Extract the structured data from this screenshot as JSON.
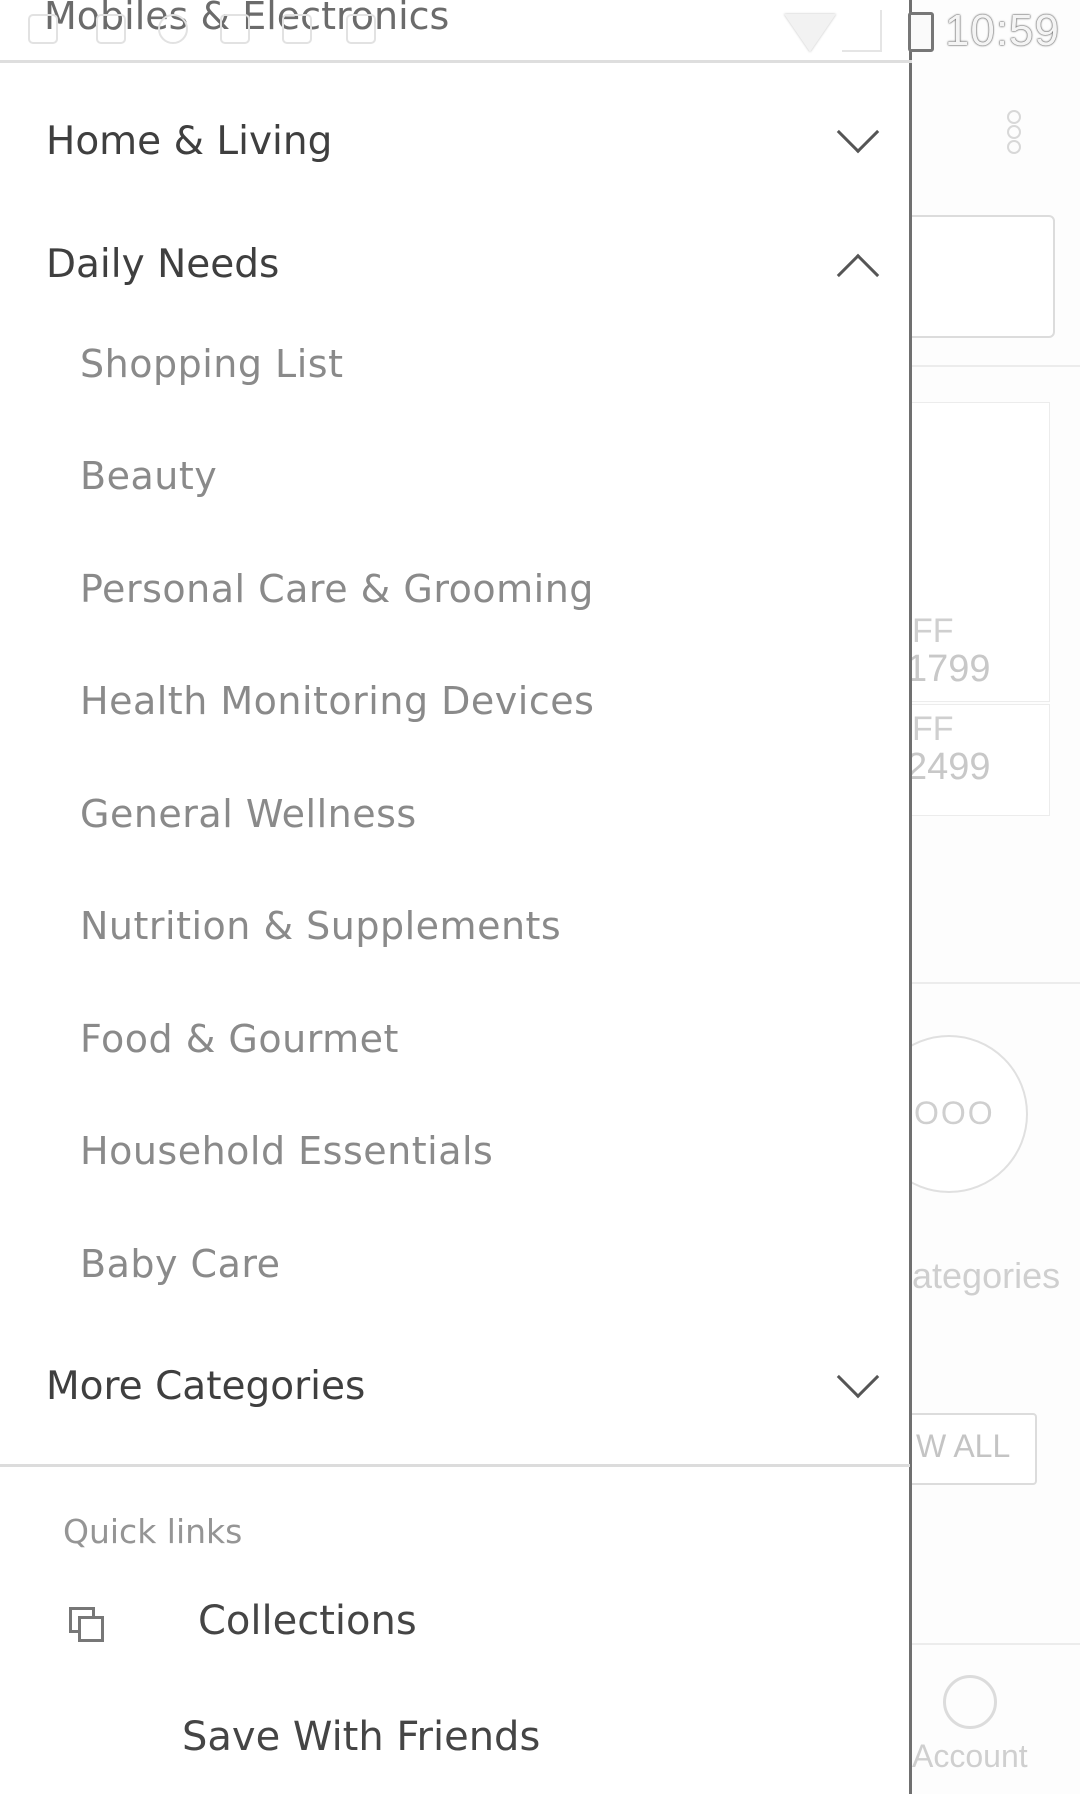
{
  "status_bar": {
    "time": "10:59"
  },
  "drawer": {
    "partial_top_title": "Mobiles & Electronics",
    "categories": [
      {
        "label": "Home & Living",
        "state": "collapsed",
        "icon": "chevron-down-icon"
      },
      {
        "label": "Daily Needs",
        "state": "expanded",
        "icon": "chevron-up-icon"
      },
      {
        "label": "More Categories",
        "state": "collapsed",
        "icon": "chevron-down-icon"
      }
    ],
    "daily_needs_items": [
      "Shopping List",
      "Beauty",
      "Personal Care & Grooming",
      "Health Monitoring Devices",
      "General Wellness",
      "Nutrition & Supplements",
      "Food & Gourmet",
      "Household Essentials",
      "Baby Care"
    ],
    "quick_links": {
      "title": "Quick links",
      "items": [
        {
          "label": "Collections",
          "icon": "collections-icon"
        },
        {
          "label": "Save With Friends",
          "icon": ""
        }
      ]
    }
  },
  "background_app": {
    "price_1_off": "FF",
    "price_1": "1799",
    "price_2_off": "FF",
    "price_2": "2499",
    "circle_label": "OOO",
    "categories_label": "ategories",
    "view_all_label": "W ALL",
    "account_label": "Account"
  },
  "colors": {
    "drawer_background": "#ffffff",
    "category_text": "#3f3f3f",
    "subitem_text": "#8a8a8a",
    "divider": "#dcdcdc"
  }
}
